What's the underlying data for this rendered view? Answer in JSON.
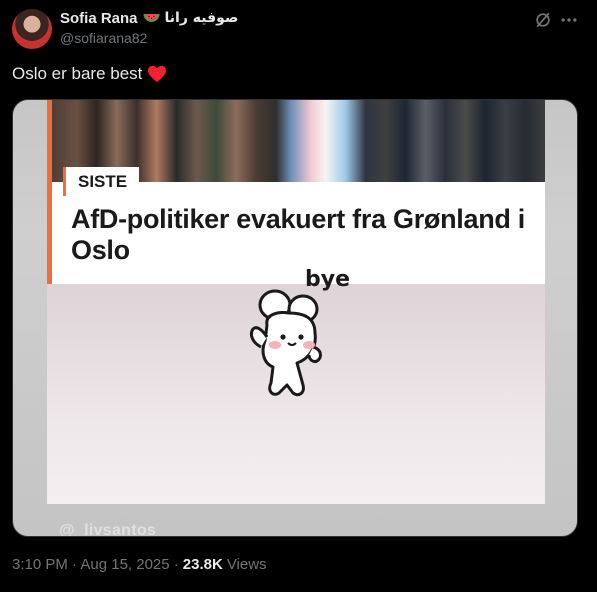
{
  "author": {
    "display_name": "Sofia Rana",
    "arabic_name": "صوفيه رانا",
    "handle": "@sofiarana82"
  },
  "tweet": {
    "text": "Oslo er bare best"
  },
  "media": {
    "badge": "SISTE",
    "headline": "AfD-politiker evakuert fra Grønland i Oslo",
    "sticker_text": "bye",
    "watermark": "@_livsantos"
  },
  "meta": {
    "timestamp": "3:10 PM · Aug 15, 2025 ·",
    "views_count": "23.8K",
    "views_label": "Views"
  },
  "icons": {
    "grok": "grok-icon",
    "more": "more-icon",
    "heart": "heart-icon",
    "watermelon": "watermelon-icon"
  },
  "colors": {
    "accent": "#f26b3a",
    "heart": "#f4212e",
    "secondary_text": "#71767b"
  }
}
